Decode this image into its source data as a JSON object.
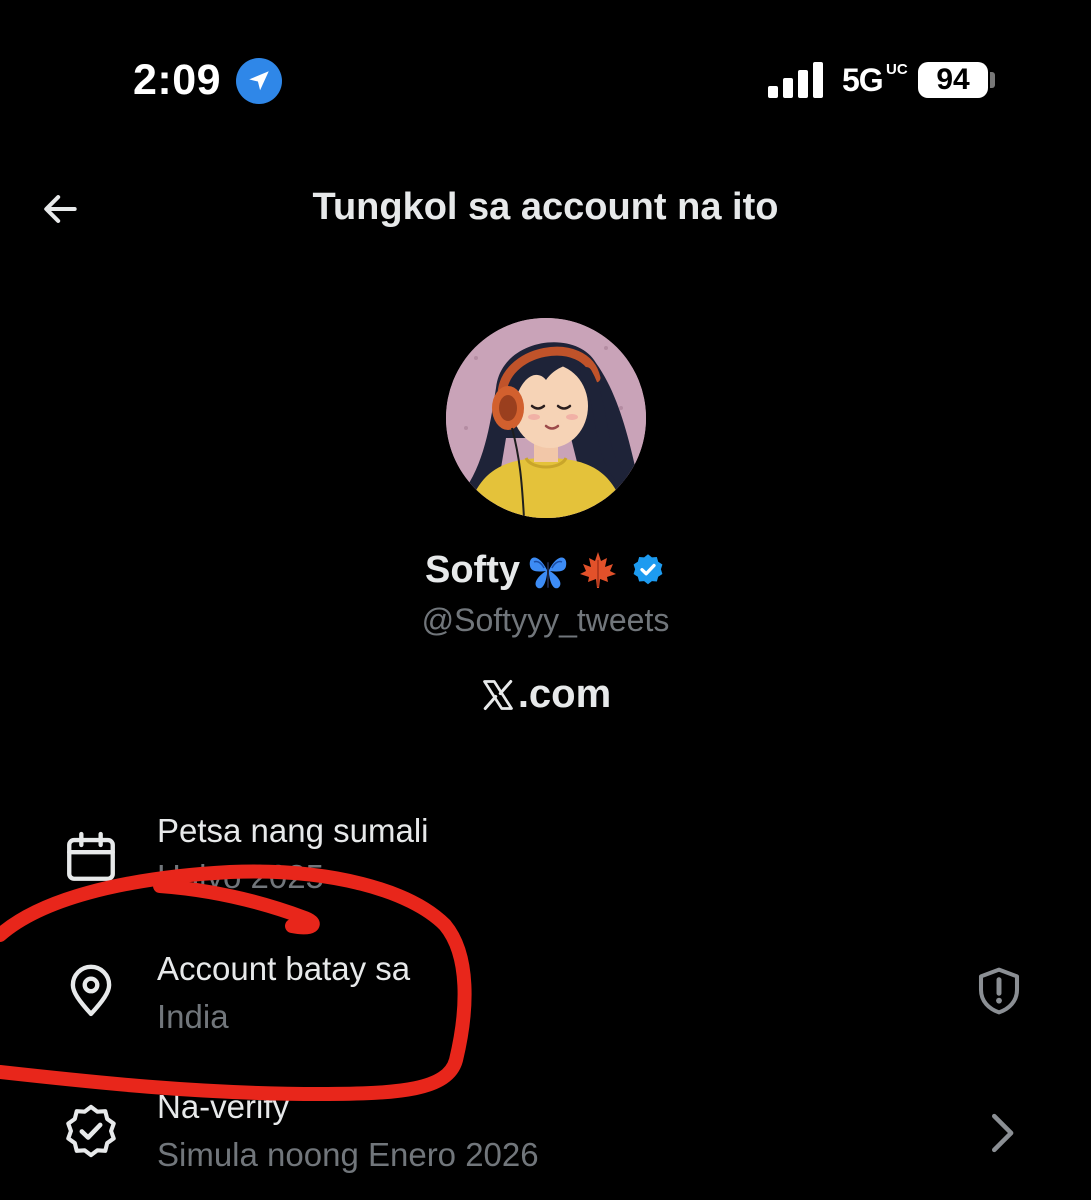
{
  "status_bar": {
    "time": "2:09",
    "network": "5G",
    "network_suffix": "UC",
    "battery": "94"
  },
  "header": {
    "title": "Tungkol sa account na ito"
  },
  "profile": {
    "display_name": "Softy",
    "emojis": [
      "butterfly",
      "maple-leaf"
    ],
    "handle": "@Softyyy_tweets",
    "site_suffix": ".com"
  },
  "info": {
    "joined": {
      "label": "Petsa nang sumali",
      "value": "Hulyo 2025"
    },
    "based_in": {
      "label": "Account batay sa",
      "value": "India"
    },
    "verified": {
      "label": "Na-verify",
      "value": "Simula noong Enero 2026"
    }
  },
  "icons": {
    "back": "arrow-left-icon",
    "location_services": "location-arrow-icon",
    "joined": "calendar-icon",
    "based_in": "map-pin-icon",
    "privacy": "shield-exclamation-icon",
    "verified": "verified-check-icon",
    "more": "chevron-right-icon"
  },
  "colors": {
    "background": "#000000",
    "primary_text": "#e7e9ea",
    "secondary_text": "#71767b",
    "verified_blue": "#1d9bf0",
    "annotation_red": "#e8261b"
  }
}
